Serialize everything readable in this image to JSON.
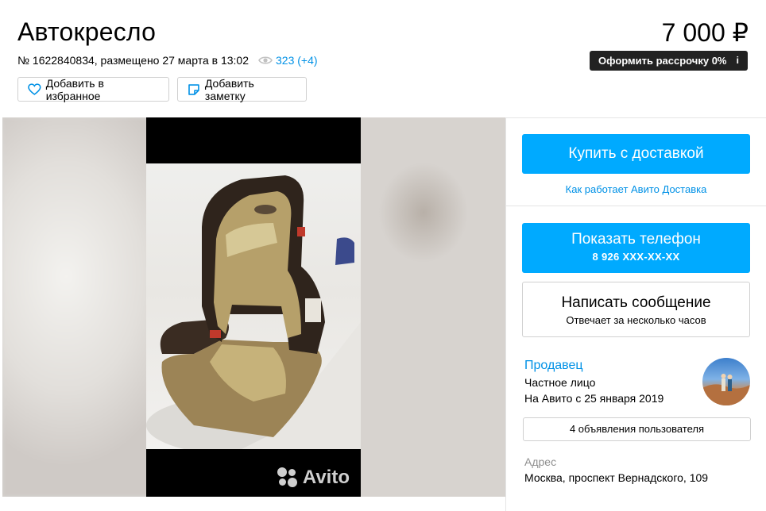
{
  "listing": {
    "title": "Автокресло",
    "meta_text": "№ 1622840834, размещено 27 марта в 13:02",
    "views": "323 (+4)",
    "price": "7 000 ₽",
    "installment_label": "Оформить рассрочку 0%",
    "installment_info": "i"
  },
  "actions": {
    "favorite_label": "Добавить в избранное",
    "note_label": "Добавить заметку"
  },
  "gallery": {
    "watermark": "Avito"
  },
  "sidebar": {
    "buy_label": "Купить с доставкой",
    "delivery_link": "Как работает Авито Доставка",
    "phone_label": "Показать телефон",
    "phone_number": "8 926 XXX-XX-XX",
    "message_label": "Написать сообщение",
    "message_sub": "Отвечает за несколько часов",
    "seller_label": "Продавец",
    "seller_type": "Частное лицо",
    "seller_since": "На Авито с 25 января 2019",
    "user_ads": "4 объявления пользователя",
    "address_label": "Адрес",
    "address_value": "Москва, проспект Вернадского, 109"
  },
  "colors": {
    "link": "#0091e6",
    "primary_button": "#00aaff",
    "installment_bg": "#222222"
  },
  "icons": [
    "eye-icon",
    "heart-icon",
    "note-icon",
    "info-icon",
    "avito-logo-icon"
  ]
}
